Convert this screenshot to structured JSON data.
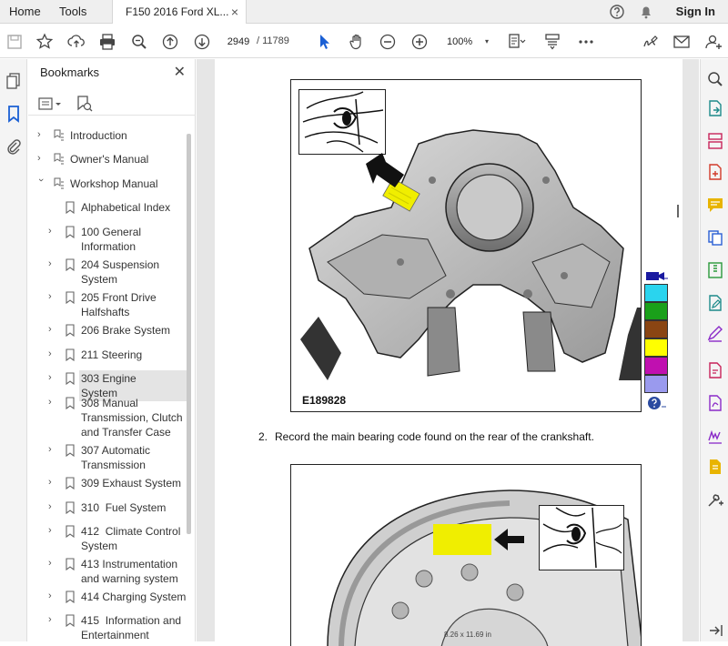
{
  "tabbar": {
    "home_label": "Home",
    "tools_label": "Tools",
    "document_tab_title": "F150 2016 Ford XL...",
    "close_glyph": "×",
    "sign_in_label": "Sign In",
    "icons": [
      "help-icon",
      "bell-icon"
    ]
  },
  "toolbar": {
    "current_page": "2949",
    "total_pages": "/ 11789",
    "zoom_level": "100%",
    "zoom_arrow": "▾",
    "icons": [
      "save-icon",
      "bookmark-star-icon",
      "upload-icon",
      "print-icon",
      "zoom-search-icon",
      "page-up-icon",
      "page-down-icon",
      "select-cursor-icon",
      "hand-tool-icon",
      "zoom-out-icon",
      "zoom-in-icon",
      "page-fit-icon",
      "scroll-mode-icon",
      "more-icon",
      "sign-icon",
      "email-icon",
      "account-icon"
    ]
  },
  "left_rail": {
    "icons": [
      "page-thumbnails-icon",
      "bookmarks-icon",
      "attachments-icon"
    ]
  },
  "bookmarks": {
    "title": "Bookmarks",
    "close_glyph": "✕",
    "items": [
      {
        "label": "Introduction",
        "level": 0,
        "state": "collapsed"
      },
      {
        "label": "Owner's Manual",
        "level": 0,
        "state": "collapsed"
      },
      {
        "label": "Workshop Manual",
        "level": 0,
        "state": "expanded"
      },
      {
        "label": "Alphabetical Index",
        "level": 1,
        "state": "leaf"
      },
      {
        "label": "100 General Information",
        "level": 1,
        "state": "collapsed"
      },
      {
        "label": "204 Suspension System",
        "level": 1,
        "state": "collapsed"
      },
      {
        "label": "205 Front Drive Halfshafts",
        "level": 1,
        "state": "collapsed"
      },
      {
        "label": "206 Brake System",
        "level": 1,
        "state": "collapsed"
      },
      {
        "label": "211 Steering",
        "level": 1,
        "state": "collapsed"
      },
      {
        "label": "303 Engine System",
        "level": 1,
        "state": "collapsed",
        "selected": true
      },
      {
        "label": "308 Manual Transmission, Clutch and Transfer Case",
        "level": 1,
        "state": "collapsed"
      },
      {
        "label": "307 Automatic Transmission",
        "level": 1,
        "state": "collapsed"
      },
      {
        "label": "309 Exhaust System",
        "level": 1,
        "state": "collapsed"
      },
      {
        "label": "310  Fuel System",
        "level": 1,
        "state": "collapsed"
      },
      {
        "label": "412  Climate Control System",
        "level": 1,
        "state": "collapsed"
      },
      {
        "label": "413 Instrumentation and warning system",
        "level": 1,
        "state": "collapsed"
      },
      {
        "label": "414 Charging System",
        "level": 1,
        "state": "collapsed"
      },
      {
        "label": "415  Information and Entertainment",
        "level": 1,
        "state": "collapsed"
      }
    ]
  },
  "document": {
    "figure1_label": "E189828",
    "step_number": "2.",
    "step_text": "Record the main bearing code found on the rear of the crankshaft.",
    "bottom_size_text": "8.26 x 11.69 in",
    "legend_colors": [
      "#2ad4ee",
      "#1aa01a",
      "#8a4513",
      "#ffff00",
      "#c010b0",
      "#9a9aee"
    ],
    "highlight_color": "#f0ee00"
  },
  "right_rail": {
    "icons": [
      "search-tool-icon",
      "export-pdf-icon",
      "organize-pages-icon",
      "create-pdf-icon",
      "comment-icon",
      "combine-files-icon",
      "compress-icon",
      "edit-pdf-icon",
      "fill-sign-icon",
      "request-signature-icon",
      "protect-icon",
      "more-tools-icon",
      "collapse-rail-icon"
    ]
  }
}
